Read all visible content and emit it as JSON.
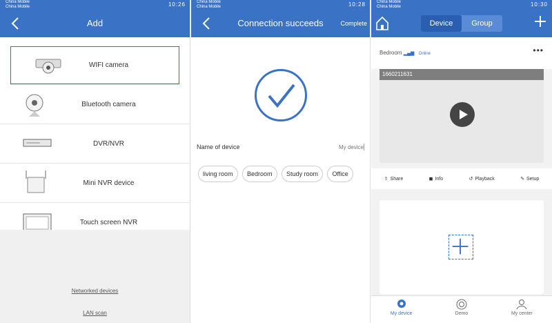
{
  "statusbar": {
    "carrier_top": "China Mobile",
    "carrier_bottom": "China Mobile",
    "time1": "10:26",
    "time2": "10:28",
    "time3": "10:30"
  },
  "p1": {
    "title": "Add",
    "items": [
      {
        "label": "WIFI camera",
        "highlight": true
      },
      {
        "label": "Bluetooth camera",
        "highlight": false
      },
      {
        "label": "DVR/NVR",
        "highlight": false
      },
      {
        "label": "Mini NVR device",
        "highlight": false
      },
      {
        "label": "Touch screen NVR",
        "highlight": false
      }
    ],
    "link1": "Networked devices",
    "link2": "LAN scan"
  },
  "p2": {
    "title": "Connection succeeds",
    "complete": "Complete",
    "name_label": "Name of device",
    "name_placeholder": "My device",
    "chips": [
      "living room",
      "Bedroom",
      "Study room",
      "Office"
    ]
  },
  "p3": {
    "tabs": [
      "Device",
      "Group"
    ],
    "room": "Bedroom",
    "status": "Online",
    "device_id": "1660211631",
    "actions": [
      "Share",
      "Info",
      "Playback",
      "Setup"
    ],
    "nav": [
      "My device",
      "Demo",
      "My center"
    ]
  },
  "colors": {
    "accent": "#3a72c6",
    "highlight": "#e03030"
  }
}
